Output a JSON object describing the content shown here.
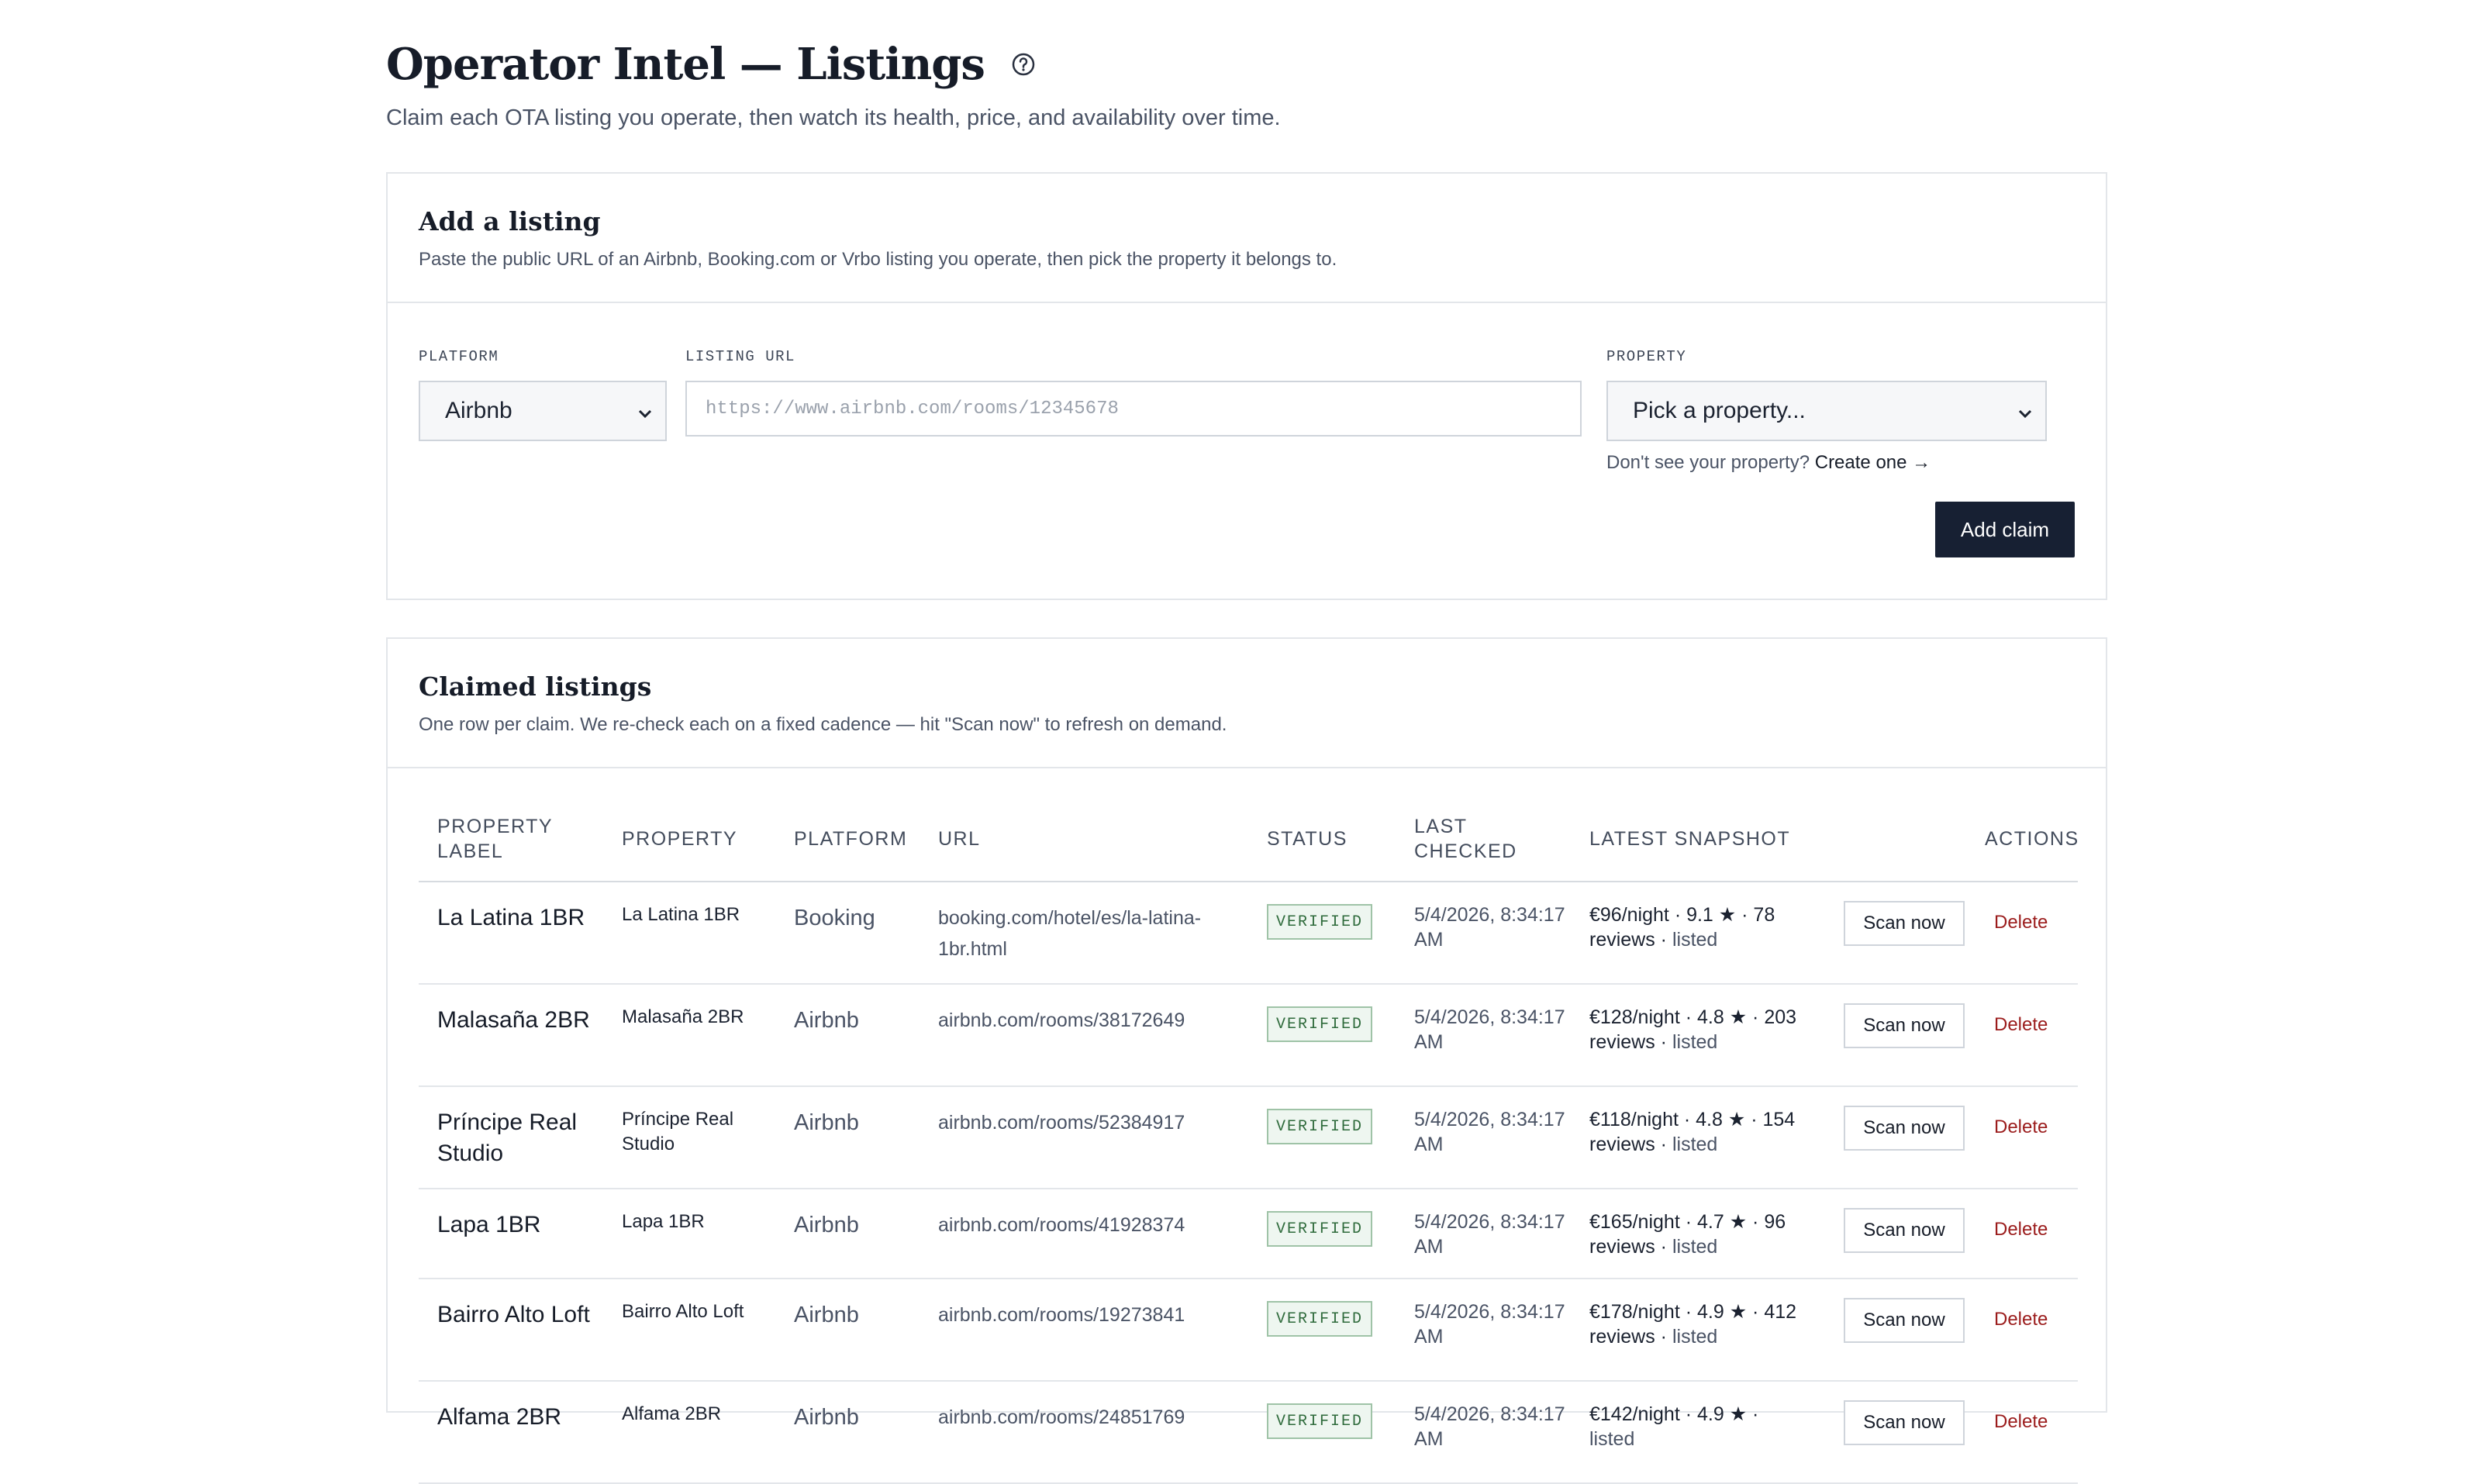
{
  "header": {
    "title": "Operator Intel — Listings",
    "subtitle": "Claim each OTA listing you operate, then watch its health, price, and availability over time."
  },
  "add_listing": {
    "title": "Add a listing",
    "description": "Paste the public URL of an Airbnb, Booking.com or Vrbo listing you operate, then pick the property it belongs to.",
    "platform_label": "PLATFORM",
    "platform_value": "Airbnb",
    "url_label": "LISTING URL",
    "url_placeholder": "https://www.airbnb.com/rooms/12345678",
    "property_label": "PROPERTY",
    "property_value": "Pick a property...",
    "hint_text": "Don't see your property?",
    "hint_link": "Create one →",
    "submit_label": "Add claim"
  },
  "claimed": {
    "title": "Claimed listings",
    "description": "One row per claim. We re-check each on a fixed cadence — hit \"Scan now\" to refresh on demand.",
    "columns": {
      "label": "PROPERTY LABEL",
      "property": "PROPERTY",
      "platform": "PLATFORM",
      "url": "URL",
      "status": "STATUS",
      "last_checked": "LAST CHECKED",
      "snapshot": "LATEST SNAPSHOT",
      "actions": "ACTIONS"
    },
    "rows": [
      {
        "label": "La Latina 1BR",
        "property": "La Latina 1BR",
        "platform": "Booking",
        "url": "booking.com/hotel/es/la-latina-1br.html",
        "status": "VERIFIED",
        "last_checked": "5/4/2026, 8:34:17 AM",
        "snapshot": "€96/night · 9.1 ★ · 78 reviews ·",
        "listed": "listed",
        "scan": "Scan now",
        "delete": "Delete"
      },
      {
        "label": "Malasaña 2BR",
        "property": "Malasaña 2BR",
        "platform": "Airbnb",
        "url": "airbnb.com/rooms/38172649",
        "status": "VERIFIED",
        "last_checked": "5/4/2026, 8:34:17 AM",
        "snapshot": "€128/night · 4.8 ★ · 203 reviews ·",
        "listed": "listed",
        "scan": "Scan now",
        "delete": "Delete"
      },
      {
        "label": "Príncipe Real Studio",
        "property": "Príncipe Real Studio",
        "platform": "Airbnb",
        "url": "airbnb.com/rooms/52384917",
        "status": "VERIFIED",
        "last_checked": "5/4/2026, 8:34:17 AM",
        "snapshot": "€118/night · 4.8 ★ · 154 reviews ·",
        "listed": "listed",
        "scan": "Scan now",
        "delete": "Delete"
      },
      {
        "label": "Lapa 1BR",
        "property": "Lapa 1BR",
        "platform": "Airbnb",
        "url": "airbnb.com/rooms/41928374",
        "status": "VERIFIED",
        "last_checked": "5/4/2026, 8:34:17 AM",
        "snapshot": "€165/night · 4.7 ★ · 96 reviews ·",
        "listed": "listed",
        "scan": "Scan now",
        "delete": "Delete"
      },
      {
        "label": "Bairro Alto Loft",
        "property": "Bairro Alto Loft",
        "platform": "Airbnb",
        "url": "airbnb.com/rooms/19273841",
        "status": "VERIFIED",
        "last_checked": "5/4/2026, 8:34:17 AM",
        "snapshot": "€178/night · 4.9 ★ · 412 reviews ·",
        "listed": "listed",
        "scan": "Scan now",
        "delete": "Delete"
      },
      {
        "label": "Alfama 2BR",
        "property": "Alfama 2BR",
        "platform": "Airbnb",
        "url": "airbnb.com/rooms/24851769",
        "status": "VERIFIED",
        "last_checked": "5/4/2026, 8:34:17 AM",
        "snapshot": "€142/night · 4.9 ★ ·",
        "listed": "listed",
        "scan": "Scan now",
        "delete": "Delete"
      }
    ]
  }
}
